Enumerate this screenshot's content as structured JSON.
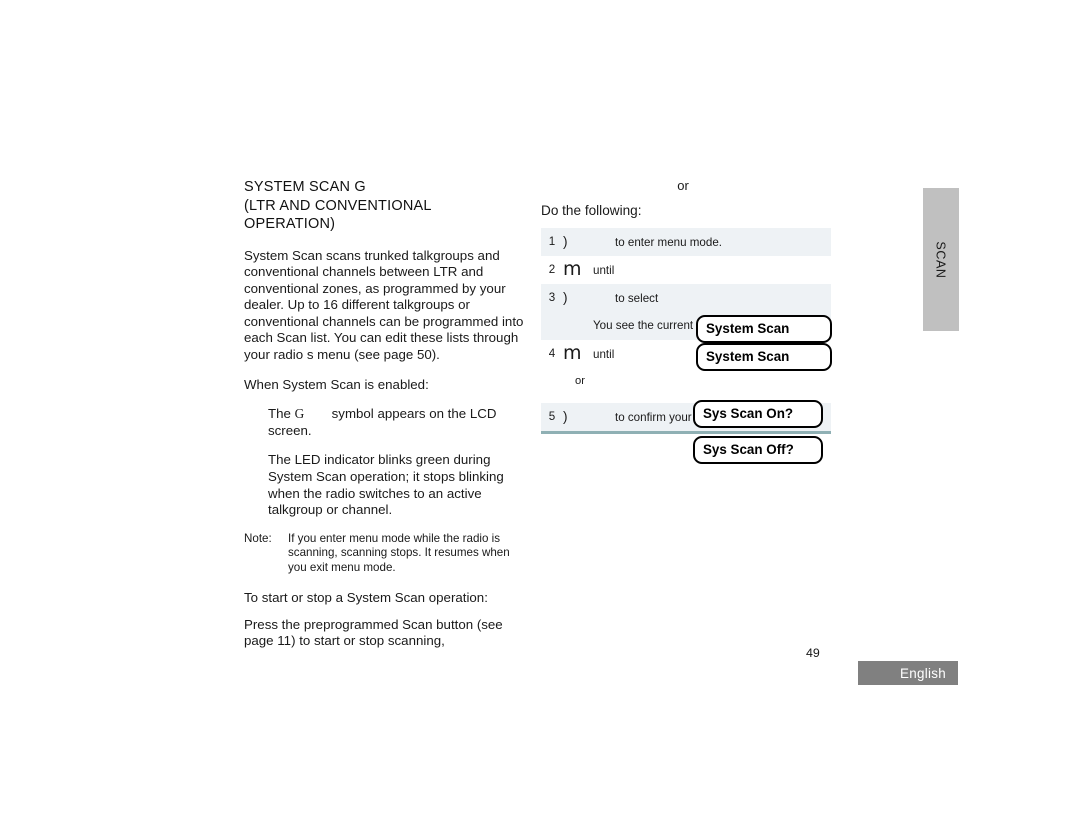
{
  "document": {
    "page_number": "49",
    "language_badge": "English",
    "side_tab_label": "SCAN"
  },
  "left_column": {
    "heading": "SYSTEM SCAN G\n(LTR AND CONVENTIONAL\nOPERATION)",
    "intro_paragraph": "System Scan scans trunked talkgroups and conventional channels between LTR and conventional zones, as programmed by your dealer. Up to 16 different talkgroups or conventional channels can be programmed into each Scan list. You can edit these lists through your radio s menu (see page 50).",
    "enabled_lead": "When System Scan is enabled:",
    "bullets": [
      {
        "symbol": "G",
        "text": "symbol appears on the LCD screen.",
        "prefix": "The"
      },
      {
        "symbol": "",
        "text": "The LED indicator blinks green during System Scan operation; it stops blinking when the radio switches to an active talkgroup or channel.",
        "prefix": ""
      }
    ],
    "note_label": "Note:",
    "note_text": "If you enter menu mode while the radio is scanning, scanning stops. It resumes when you exit menu mode.",
    "start_stop_heading": "To start or stop a System Scan operation:",
    "start_stop_text": "Press the preprogrammed Scan button (see page 11) to start or stop scanning,"
  },
  "right_column": {
    "or_label": "or",
    "do_following": "Do the following:",
    "steps": [
      {
        "num": "1",
        "key": ")",
        "text": "to enter menu mode.",
        "shaded": true,
        "indented": true
      },
      {
        "num": "2",
        "key": "m",
        "text": "until",
        "shaded": false,
        "indented": false
      },
      {
        "num": "3",
        "key": ")",
        "text": "to select",
        "shaded": true,
        "indented": false
      }
    ],
    "status_text": "You see the current scan status.",
    "step4": {
      "num": "4",
      "key": "m",
      "text": "until"
    },
    "or_row_label": "or",
    "step5": {
      "num": "5",
      "key": ")",
      "text": "to confirm your selection."
    },
    "lcd_boxes": [
      "System Scan",
      "System Scan",
      "Sys Scan On?",
      "Sys Scan Off?"
    ]
  },
  "colors": {
    "row_shade": "#eef2f5",
    "table_bottom_rule": "#8fb0b4",
    "side_tab_gray": "#c0c0c0",
    "badge_gray": "#808080"
  }
}
